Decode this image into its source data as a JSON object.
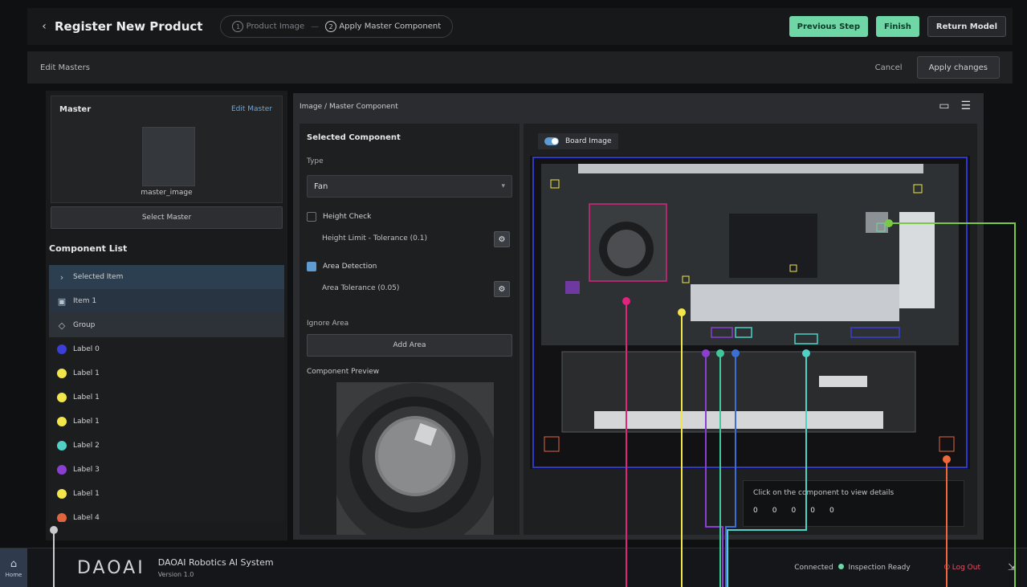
{
  "header": {
    "title": "Register New Product",
    "steps": [
      {
        "num": "1",
        "label": "Product Image"
      },
      {
        "num": "2",
        "label": "Apply Master Component"
      }
    ],
    "actions": [
      "Previous Step",
      "Finish",
      "Return Model"
    ]
  },
  "subbar": {
    "breadcrumb": "Edit Masters",
    "cancel": "Cancel",
    "apply": "Apply changes"
  },
  "master": {
    "title": "Master",
    "link": "Edit Master",
    "thumb_label": "master_image",
    "select_button": "Select Master"
  },
  "component_list": {
    "title": "Component List",
    "items": [
      {
        "label": "Selected Item",
        "kind": "icon",
        "icon": "chevron-icon",
        "color": ""
      },
      {
        "label": "Item 1",
        "kind": "icon",
        "icon": "folder-icon",
        "color": ""
      },
      {
        "label": "Group",
        "kind": "icon",
        "icon": "group-icon",
        "color": ""
      },
      {
        "label": "Label 0",
        "kind": "dot",
        "color": "#3b3fd6"
      },
      {
        "label": "Label 1",
        "kind": "dot",
        "color": "#f2e64a"
      },
      {
        "label": "Label 1",
        "kind": "dot",
        "color": "#f2e64a"
      },
      {
        "label": "Label 1",
        "kind": "dot",
        "color": "#f2e64a"
      },
      {
        "label": "Label 2",
        "kind": "dot",
        "color": "#4fd1c5"
      },
      {
        "label": "Label 3",
        "kind": "dot",
        "color": "#8a3fd1"
      },
      {
        "label": "Label 1",
        "kind": "dot",
        "color": "#f2e64a"
      },
      {
        "label": "Label 4",
        "kind": "dot",
        "color": "#e0653f"
      }
    ]
  },
  "center": {
    "header": "Image / Master Component",
    "selected_title": "Selected Component",
    "type_label": "Type",
    "type_value": "Fan",
    "option1_label": "Height Check",
    "option1_sub": "Height Limit - Tolerance (0.1)",
    "option2_label": "Area Detection",
    "option2_sub": "Area Tolerance (0.05)",
    "ignore_label": "Ignore Area",
    "add_button": "Add Area",
    "preview_label": "Component Preview",
    "image_tag": "Board Image",
    "info_line": "Click on the component to view details",
    "info_values": [
      "0",
      "0",
      "0",
      "0",
      "0"
    ]
  },
  "footer": {
    "home_label": "Home",
    "logo": "DAOAI",
    "app_name": "DAOAI Robotics AI System",
    "version": "Version 1.0",
    "status": "Connected",
    "status_detail": "Inspection Ready",
    "logout": "Log Out"
  },
  "colors": {
    "accent_green": "#6fd7a6",
    "accent_blue": "#5e9bd1",
    "danger": "#e0536b"
  }
}
